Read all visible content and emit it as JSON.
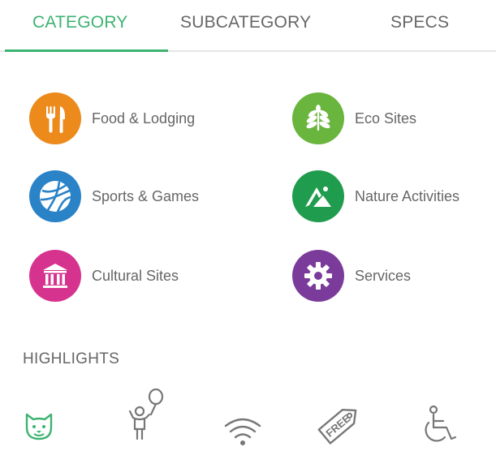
{
  "tabs": [
    {
      "label": "CATEGORY",
      "active": true
    },
    {
      "label": "SUBCATEGORY",
      "active": false
    },
    {
      "label": "SPECS",
      "active": false
    }
  ],
  "categories": [
    {
      "label": "Food & Lodging",
      "color": "#ec8a1c",
      "icon": "fork-knife-icon"
    },
    {
      "label": "Eco Sites",
      "color": "#6ab53d",
      "icon": "leaf-icon"
    },
    {
      "label": "Sports & Games",
      "color": "#2a82c7",
      "icon": "ball-icon"
    },
    {
      "label": "Nature Activities",
      "color": "#1f9c4e",
      "icon": "mountain-icon"
    },
    {
      "label": "Cultural Sites",
      "color": "#d6338f",
      "icon": "museum-icon"
    },
    {
      "label": "Services",
      "color": "#7b3b9a",
      "icon": "gear-icon"
    }
  ],
  "highlights": {
    "title": "HIGHLIGHTS",
    "items": [
      {
        "icon": "pet-friendly-icon",
        "color": "#3cb371",
        "active": true
      },
      {
        "icon": "kid-friendly-icon",
        "color": "#777777",
        "active": false
      },
      {
        "icon": "wifi-icon",
        "color": "#777777",
        "active": false
      },
      {
        "icon": "free-tag-icon",
        "color": "#777777",
        "active": false,
        "tag_text": "FREE"
      },
      {
        "icon": "wheelchair-icon",
        "color": "#777777",
        "active": false
      }
    ]
  },
  "colors": {
    "accent": "#3cb371",
    "text": "#666666",
    "divider": "#e6e6e6"
  }
}
